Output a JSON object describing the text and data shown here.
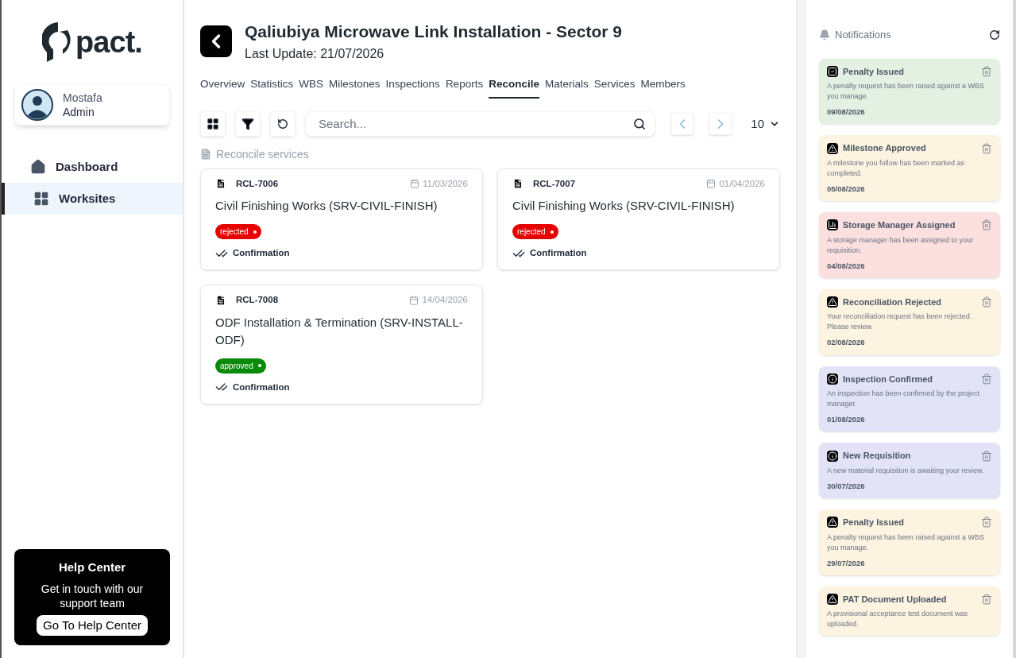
{
  "sidebar": {
    "logo": "pact.",
    "user": {
      "name": "Mostafa",
      "role": "Admin"
    },
    "items": [
      {
        "label": "Dashboard",
        "kind": "home",
        "selected": false
      },
      {
        "label": "Worksites",
        "kind": "grid",
        "selected": true
      }
    ],
    "help": {
      "title": "Help Center",
      "text": "Get in touch with our support team",
      "button": "Go To Help Center"
    }
  },
  "header": {
    "title": "Qaliubiya Microwave Link Installation - Sector 9",
    "subtitle": "Last Update: 21/07/2026"
  },
  "tabs": [
    {
      "label": "Overview",
      "selected": false
    },
    {
      "label": "Statistics",
      "selected": false
    },
    {
      "label": "WBS",
      "selected": false
    },
    {
      "label": "Milestones",
      "selected": false
    },
    {
      "label": "Inspections",
      "selected": false
    },
    {
      "label": "Reports",
      "selected": false
    },
    {
      "label": "Reconcile",
      "selected": true
    },
    {
      "label": "Materials",
      "selected": false
    },
    {
      "label": "Services",
      "selected": false
    },
    {
      "label": "Members",
      "selected": false
    }
  ],
  "toolbar": {
    "search_placeholder": "Search...",
    "page_size": "10"
  },
  "section_label": "Reconcile services",
  "cards": [
    {
      "id": "RCL-7006",
      "date": "11/03/2026",
      "title": "Civil Finishing Works (SRV-CIVIL-FINISH)",
      "status": "rejected",
      "action": "Confirmation"
    },
    {
      "id": "RCL-7007",
      "date": "01/04/2026",
      "title": "Civil Finishing Works (SRV-CIVIL-FINISH)",
      "status": "rejected",
      "action": "Confirmation"
    },
    {
      "id": "RCL-7008",
      "date": "14/04/2026",
      "title": "ODF Installation & Termination (SRV-INSTALL-ODF)",
      "status": "approved",
      "action": "Confirmation"
    }
  ],
  "notifications": {
    "title": "Notifications",
    "items": [
      {
        "kind": "check",
        "color": "#e4f0e2",
        "title": "Penalty Issued",
        "text": "A penalty request has been raised against a WBS you manage.",
        "date": "09/08/2026"
      },
      {
        "kind": "warning",
        "color": "#fdf3e1",
        "title": "Milestone Approved",
        "text": "A milestone you follow has been marked as completed.",
        "date": "05/08/2026"
      },
      {
        "kind": "chart",
        "color": "#fbe0df",
        "title": "Storage Manager Assigned",
        "text": "A storage manager has been assigned to your requisition.",
        "date": "04/08/2026"
      },
      {
        "kind": "warning",
        "color": "#fdf3e1",
        "title": "Reconciliation Rejected",
        "text": "Your reconciliation request has been rejected. Please review.",
        "date": "02/08/2026"
      },
      {
        "kind": "info",
        "color": "#e3e3f7",
        "title": "Inspection Confirmed",
        "text": "An inspection has been confirmed by the project manager.",
        "date": "01/08/2026"
      },
      {
        "kind": "info",
        "color": "#e3e3f7",
        "title": "New Requisition",
        "text": "A new material requisition is awaiting your review.",
        "date": "30/07/2026"
      },
      {
        "kind": "warning",
        "color": "#fdf3e1",
        "title": "Penalty Issued",
        "text": "A penalty request has been raised against a WBS you manage.",
        "date": "29/07/2026"
      },
      {
        "kind": "warning",
        "color": "#fdf3e1",
        "title": "PAT Document Uploaded",
        "text": "A provisional acceptance test document was uploaded."
      }
    ]
  }
}
